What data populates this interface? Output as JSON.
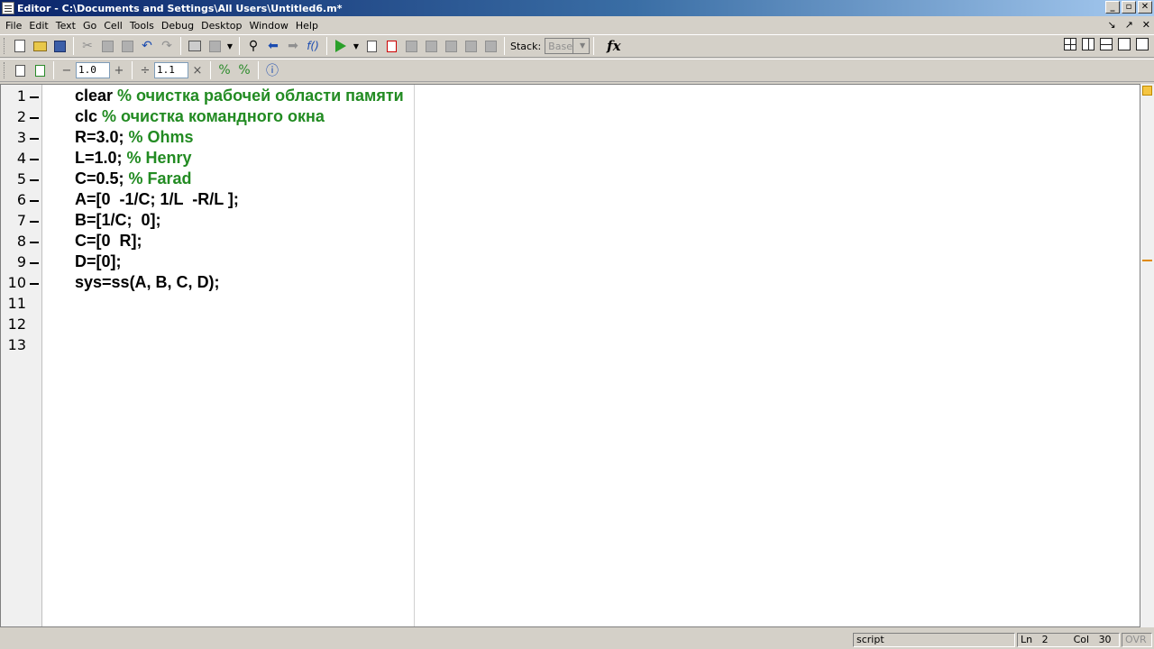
{
  "window": {
    "title": "Editor - C:\\Documents and Settings\\All Users\\Untitled6.m*",
    "minimize_label": "_",
    "restore_label": "▫",
    "close_label": "✕"
  },
  "menu": {
    "items": [
      "File",
      "Edit",
      "Text",
      "Go",
      "Cell",
      "Tools",
      "Debug",
      "Desktop",
      "Window",
      "Help"
    ],
    "right_glyphs": [
      "↘",
      "↗",
      "✕"
    ]
  },
  "toolbar": {
    "stack_label": "Stack:",
    "stack_value": "Base",
    "fx_label": "fx"
  },
  "cell_toolbar": {
    "minus": "−",
    "value1": "1.0",
    "plus": "+",
    "divide": "÷",
    "value2": "1.1",
    "times": "×"
  },
  "editor": {
    "line_numbers": [
      "1",
      "2",
      "3",
      "4",
      "5",
      "6",
      "7",
      "8",
      "9",
      "10",
      "11",
      "12",
      "13"
    ],
    "lines": [
      {
        "code": "clear ",
        "comment": "% очистка рабочей области памяти"
      },
      {
        "code": "clc ",
        "comment": "% очистка командного окна"
      },
      {
        "code": "R=3.0; ",
        "comment": "% Ohms"
      },
      {
        "code": "L=1.0; ",
        "comment": "% Henry"
      },
      {
        "code": "C=0.5; ",
        "comment": "% Farad"
      },
      {
        "code": "A=[0  -1/C; 1/L  -R/L ];",
        "comment": ""
      },
      {
        "code": "B=[1/C;  0];",
        "comment": ""
      },
      {
        "code": "C=[0  R];",
        "comment": ""
      },
      {
        "code": "D=[0];",
        "comment": ""
      },
      {
        "code": "sys=ss(A, B, C, D);",
        "comment": ""
      }
    ],
    "colors": {
      "comment": "#228b22",
      "code": "#000000"
    }
  },
  "status": {
    "mode": "script",
    "ln_label": "Ln",
    "ln_value": "2",
    "col_label": "Col",
    "col_value": "30",
    "ovr": "OVR"
  }
}
